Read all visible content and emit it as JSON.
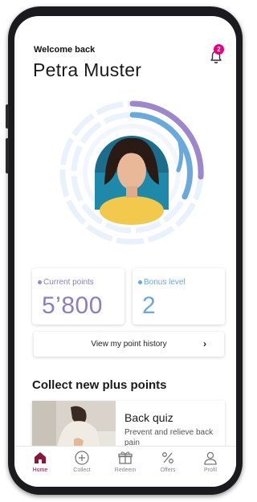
{
  "header": {
    "welcome_label": "Welcome back",
    "user_name": "Petra Muster",
    "notification_count": "2"
  },
  "stats": {
    "current_points_label": "Current points",
    "current_points_value": "5’800",
    "bonus_level_label": "Bonus level",
    "bonus_level_value": "2"
  },
  "history_button": {
    "label": "View my point history",
    "chevron": "›"
  },
  "section": {
    "title": "Collect new plus points"
  },
  "offer_card": {
    "title": "Back quiz",
    "subtitle": "Prevent and relieve back pain"
  },
  "tabbar": {
    "items": [
      {
        "label": "Home",
        "icon": "home-icon",
        "active": true
      },
      {
        "label": "Collect",
        "icon": "plus-circle-icon"
      },
      {
        "label": "Redeem",
        "icon": "gift-icon"
      },
      {
        "label": "Offers",
        "icon": "percent-icon"
      },
      {
        "label": "Profil",
        "icon": "user-icon"
      }
    ]
  },
  "colors": {
    "brand": "#8a1538",
    "badge": "#e6007e",
    "purple": "#9b87c9",
    "blue": "#6aa9dc",
    "ring_bg": "#e8f1fb"
  }
}
